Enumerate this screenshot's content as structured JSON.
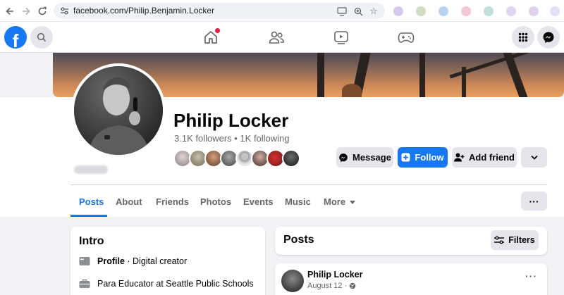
{
  "browser": {
    "url": "facebook.com/Philip.Benjamin.Locker"
  },
  "profile": {
    "name": "Philip Locker",
    "stats": "3.1K followers • 1K following"
  },
  "actions": {
    "message": "Message",
    "follow": "Follow",
    "add_friend": "Add friend"
  },
  "tabs": [
    {
      "label": "Posts",
      "active": true
    },
    {
      "label": "About"
    },
    {
      "label": "Friends"
    },
    {
      "label": "Photos"
    },
    {
      "label": "Events"
    },
    {
      "label": "Music"
    },
    {
      "label": "More"
    }
  ],
  "more_options": "···",
  "intro": {
    "title": "Intro",
    "rows": [
      {
        "icon": "profile-card-icon",
        "bold": "Profile",
        "text": " · Digital creator"
      },
      {
        "icon": "briefcase-icon",
        "bold": "",
        "text": "Para Educator at Seattle Public Schools"
      }
    ]
  },
  "posts": {
    "title": "Posts",
    "filters_label": "Filters"
  },
  "post": {
    "author": "Philip Locker",
    "date": "August 12",
    "separator": "·"
  },
  "icons": {
    "home": "home-icon",
    "friends": "friends-icon",
    "watch": "watch-icon",
    "gaming": "gaming-icon",
    "menu": "grid-menu-icon",
    "messenger": "messenger-icon",
    "search": "search-icon"
  },
  "colors": {
    "brand": "#1877f2",
    "notification": "#e41e3f",
    "background": "#f0f2f5"
  }
}
